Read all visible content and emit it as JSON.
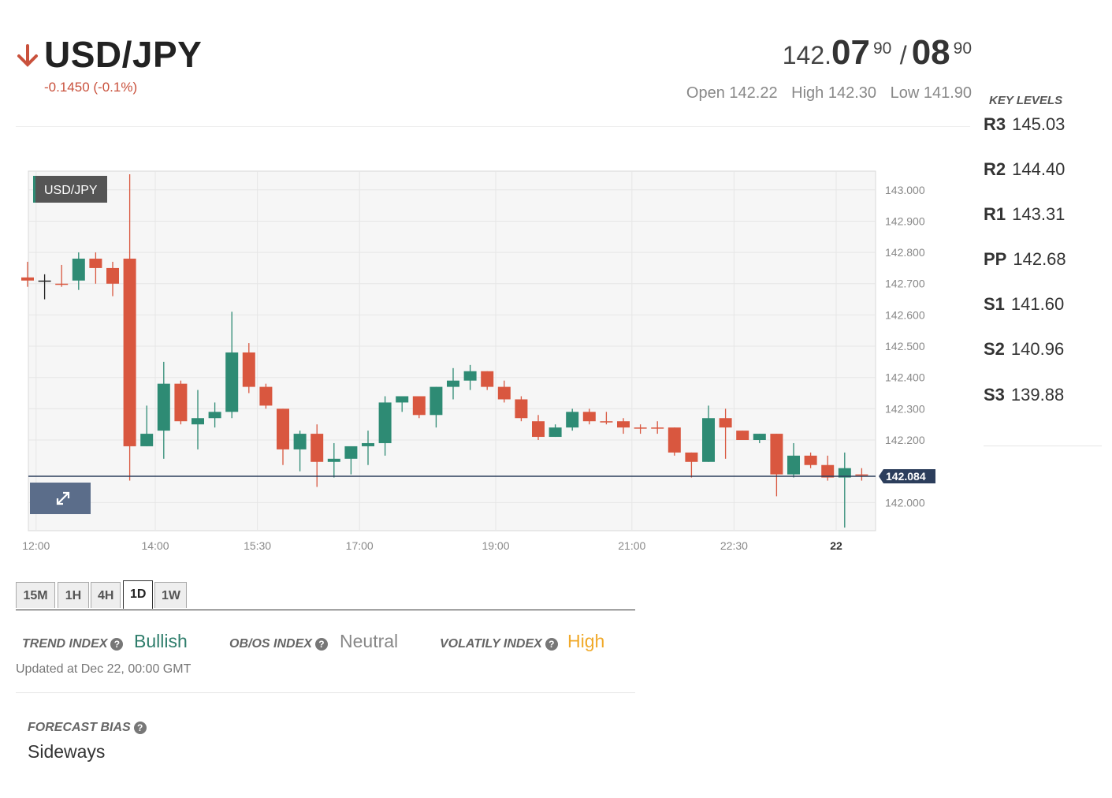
{
  "header": {
    "pair": "USD/JPY",
    "direction_icon": "arrow-down-icon",
    "change": "-0.1450 (-0.1%)",
    "bid": {
      "base": "142.",
      "big": "07",
      "sup": "90"
    },
    "separator": "/",
    "ask": {
      "big": "08",
      "sup": "90"
    },
    "open": "Open 142.22",
    "high": "High 142.30",
    "low": "Low 141.90"
  },
  "key_levels": {
    "title": "KEY LEVELS",
    "levels": [
      {
        "name": "R3",
        "value": "145.03"
      },
      {
        "name": "R2",
        "value": "144.40"
      },
      {
        "name": "R1",
        "value": "143.31"
      },
      {
        "name": "PP",
        "value": "142.68"
      },
      {
        "name": "S1",
        "value": "141.60"
      },
      {
        "name": "S2",
        "value": "140.96"
      },
      {
        "name": "S3",
        "value": "139.88"
      }
    ]
  },
  "chart_data": {
    "type": "candlestick",
    "symbol_label": "USD/JPY",
    "current_price_label": "142.084",
    "current_price": 142.084,
    "ylim": [
      141.91,
      143.06
    ],
    "y_ticks": [
      "143.000",
      "142.900",
      "142.800",
      "142.700",
      "142.600",
      "142.500",
      "142.400",
      "142.300",
      "142.200",
      "142.000"
    ],
    "x_ticks": [
      {
        "label": "12:00",
        "index": 0.5,
        "bold": false
      },
      {
        "label": "14:00",
        "index": 7.5,
        "bold": false
      },
      {
        "label": "15:30",
        "index": 13.5,
        "bold": false
      },
      {
        "label": "17:00",
        "index": 19.5,
        "bold": false
      },
      {
        "label": "19:00",
        "index": 27.5,
        "bold": false
      },
      {
        "label": "21:00",
        "index": 35.5,
        "bold": false
      },
      {
        "label": "22:30",
        "index": 41.5,
        "bold": false
      },
      {
        "label": "22",
        "index": 47.5,
        "bold": true
      }
    ],
    "candles": [
      {
        "o": 142.72,
        "h": 142.77,
        "l": 142.69,
        "c": 142.71
      },
      {
        "o": 142.71,
        "h": 142.73,
        "l": 142.65,
        "c": 142.71
      },
      {
        "o": 142.7,
        "h": 142.76,
        "l": 142.69,
        "c": 142.7
      },
      {
        "o": 142.71,
        "h": 142.8,
        "l": 142.68,
        "c": 142.78
      },
      {
        "o": 142.78,
        "h": 142.8,
        "l": 142.7,
        "c": 142.75
      },
      {
        "o": 142.75,
        "h": 142.77,
        "l": 142.66,
        "c": 142.7
      },
      {
        "o": 142.78,
        "h": 143.05,
        "l": 142.07,
        "c": 142.18
      },
      {
        "o": 142.18,
        "h": 142.31,
        "l": 142.18,
        "c": 142.22
      },
      {
        "o": 142.23,
        "h": 142.45,
        "l": 142.14,
        "c": 142.38
      },
      {
        "o": 142.38,
        "h": 142.39,
        "l": 142.25,
        "c": 142.26
      },
      {
        "o": 142.25,
        "h": 142.36,
        "l": 142.17,
        "c": 142.27
      },
      {
        "o": 142.27,
        "h": 142.32,
        "l": 142.24,
        "c": 142.29
      },
      {
        "o": 142.29,
        "h": 142.61,
        "l": 142.27,
        "c": 142.48
      },
      {
        "o": 142.48,
        "h": 142.51,
        "l": 142.35,
        "c": 142.37
      },
      {
        "o": 142.37,
        "h": 142.38,
        "l": 142.3,
        "c": 142.31
      },
      {
        "o": 142.3,
        "h": 142.3,
        "l": 142.12,
        "c": 142.17
      },
      {
        "o": 142.17,
        "h": 142.23,
        "l": 142.1,
        "c": 142.22
      },
      {
        "o": 142.22,
        "h": 142.25,
        "l": 142.05,
        "c": 142.13
      },
      {
        "o": 142.13,
        "h": 142.19,
        "l": 142.08,
        "c": 142.14
      },
      {
        "o": 142.14,
        "h": 142.18,
        "l": 142.09,
        "c": 142.18
      },
      {
        "o": 142.18,
        "h": 142.23,
        "l": 142.12,
        "c": 142.19
      },
      {
        "o": 142.19,
        "h": 142.34,
        "l": 142.15,
        "c": 142.32
      },
      {
        "o": 142.32,
        "h": 142.34,
        "l": 142.29,
        "c": 142.34
      },
      {
        "o": 142.34,
        "h": 142.34,
        "l": 142.27,
        "c": 142.28
      },
      {
        "o": 142.28,
        "h": 142.37,
        "l": 142.24,
        "c": 142.37
      },
      {
        "o": 142.37,
        "h": 142.43,
        "l": 142.33,
        "c": 142.39
      },
      {
        "o": 142.39,
        "h": 142.44,
        "l": 142.36,
        "c": 142.42
      },
      {
        "o": 142.42,
        "h": 142.42,
        "l": 142.36,
        "c": 142.37
      },
      {
        "o": 142.37,
        "h": 142.39,
        "l": 142.32,
        "c": 142.33
      },
      {
        "o": 142.33,
        "h": 142.34,
        "l": 142.26,
        "c": 142.27
      },
      {
        "o": 142.26,
        "h": 142.28,
        "l": 142.2,
        "c": 142.21
      },
      {
        "o": 142.21,
        "h": 142.25,
        "l": 142.21,
        "c": 142.24
      },
      {
        "o": 142.24,
        "h": 142.3,
        "l": 142.23,
        "c": 142.29
      },
      {
        "o": 142.29,
        "h": 142.3,
        "l": 142.25,
        "c": 142.26
      },
      {
        "o": 142.26,
        "h": 142.29,
        "l": 142.25,
        "c": 142.26
      },
      {
        "o": 142.26,
        "h": 142.27,
        "l": 142.22,
        "c": 142.24
      },
      {
        "o": 142.24,
        "h": 142.25,
        "l": 142.22,
        "c": 142.24
      },
      {
        "o": 142.24,
        "h": 142.26,
        "l": 142.22,
        "c": 142.24
      },
      {
        "o": 142.24,
        "h": 142.24,
        "l": 142.15,
        "c": 142.16
      },
      {
        "o": 142.16,
        "h": 142.16,
        "l": 142.08,
        "c": 142.13
      },
      {
        "o": 142.13,
        "h": 142.31,
        "l": 142.13,
        "c": 142.27
      },
      {
        "o": 142.27,
        "h": 142.3,
        "l": 142.14,
        "c": 142.24
      },
      {
        "o": 142.23,
        "h": 142.23,
        "l": 142.2,
        "c": 142.2
      },
      {
        "o": 142.2,
        "h": 142.22,
        "l": 142.19,
        "c": 142.22
      },
      {
        "o": 142.22,
        "h": 142.22,
        "l": 142.02,
        "c": 142.09
      },
      {
        "o": 142.09,
        "h": 142.19,
        "l": 142.08,
        "c": 142.15
      },
      {
        "o": 142.15,
        "h": 142.16,
        "l": 142.11,
        "c": 142.12
      },
      {
        "o": 142.12,
        "h": 142.15,
        "l": 142.07,
        "c": 142.08
      },
      {
        "o": 142.08,
        "h": 142.16,
        "l": 141.92,
        "c": 142.11
      },
      {
        "o": 142.09,
        "h": 142.11,
        "l": 142.07,
        "c": 142.09
      }
    ]
  },
  "timeframes": {
    "items": [
      "15M",
      "1H",
      "4H",
      "1D",
      "1W"
    ],
    "active": "1D"
  },
  "indices": {
    "trend": {
      "label": "TREND INDEX",
      "value": "Bullish",
      "color": "#2e7d6b"
    },
    "obos": {
      "label": "OB/OS INDEX",
      "value": "Neutral",
      "color": "#888888"
    },
    "volatility": {
      "label": "VOLATILY INDEX",
      "value": "High",
      "color": "#f0a92a"
    },
    "help_icon": "question-circle-icon",
    "help_glyph": "?"
  },
  "updated": "Updated at Dec 22, 00:00 GMT",
  "forecast": {
    "label": "FORECAST BIAS",
    "value": "Sideways"
  },
  "colors": {
    "bull": "#2e8b74",
    "bear": "#d9573f",
    "accent_red": "#c9513c",
    "price_tag": "#2c3e5c"
  }
}
